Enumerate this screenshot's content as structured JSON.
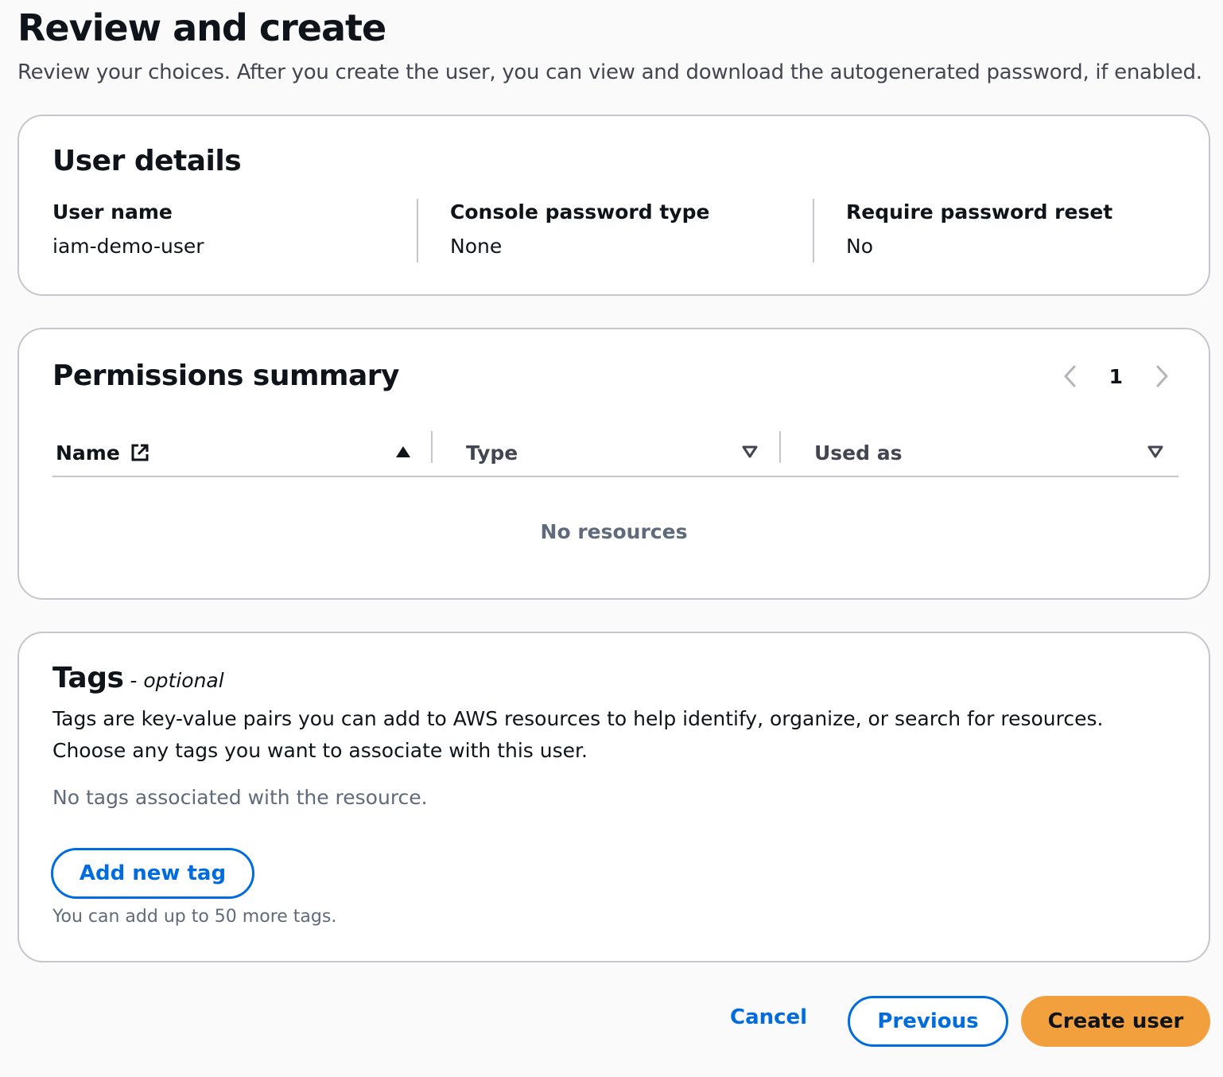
{
  "page": {
    "title": "Review and create",
    "description": "Review your choices. After you create the user, you can view and download the autogenerated password, if enabled."
  },
  "user_details": {
    "title": "User details",
    "fields": [
      {
        "label": "User name",
        "value": "iam-demo-user"
      },
      {
        "label": "Console password type",
        "value": "None"
      },
      {
        "label": "Require password reset",
        "value": "No"
      }
    ]
  },
  "permissions": {
    "title": "Permissions summary",
    "pagination": {
      "current_page": "1",
      "prev_icon": "chevron-left-icon",
      "next_icon": "chevron-right-icon"
    },
    "columns": [
      {
        "label": "Name",
        "icon": "external-link-icon",
        "sort": "ascending"
      },
      {
        "label": "Type",
        "sort": "none"
      },
      {
        "label": "Used as",
        "sort": "none"
      }
    ],
    "empty_message": "No resources"
  },
  "tags": {
    "title": "Tags",
    "optional_label": "- optional",
    "description": "Tags are key-value pairs you can add to AWS resources to help identify, organize, or search for resources. Choose any tags you want to associate with this user.",
    "empty_message": "No tags associated with the resource.",
    "add_button": "Add new tag",
    "hint": "You can add up to 50 more tags."
  },
  "footer": {
    "cancel": "Cancel",
    "previous": "Previous",
    "create": "Create user"
  },
  "colors": {
    "accent": "#006ce0",
    "primary_button": "#f2a03d",
    "border": "#c6c6cd"
  }
}
